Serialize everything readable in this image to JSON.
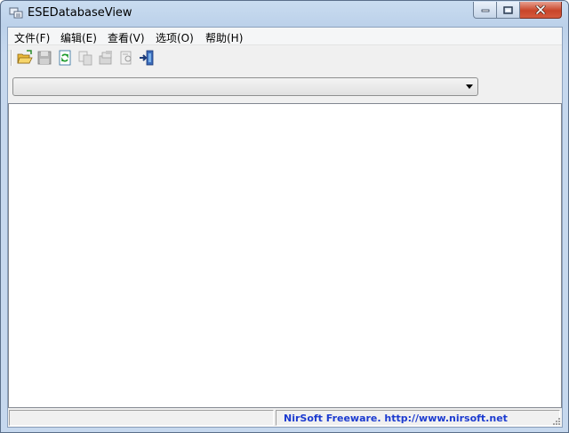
{
  "window": {
    "title": "ESEDatabaseView"
  },
  "menu": [
    {
      "label": "文件(F)"
    },
    {
      "label": "编辑(E)"
    },
    {
      "label": "查看(V)"
    },
    {
      "label": "选项(O)"
    },
    {
      "label": "帮助(H)"
    }
  ],
  "toolbar": {
    "buttons": [
      {
        "icon": "open-folder-icon"
      },
      {
        "icon": "save-icon"
      },
      {
        "icon": "refresh-icon"
      },
      {
        "icon": "copy-icon"
      },
      {
        "icon": "properties-icon"
      },
      {
        "icon": "html-report-icon"
      },
      {
        "icon": "exit-icon"
      }
    ]
  },
  "table_combo": {
    "value": ""
  },
  "status": {
    "left_text": "",
    "link_text": "NirSoft Freeware.  http://www.nirsoft.net"
  },
  "colors": {
    "status_link": "#1c3bd0",
    "close_button": "#c9452a",
    "title_bar": "#bcd1ea"
  }
}
